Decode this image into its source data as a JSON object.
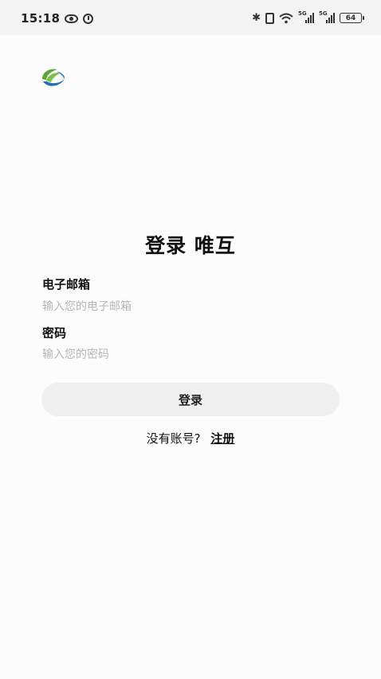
{
  "status_bar": {
    "time": "15:18",
    "network_left": "5G",
    "network_right": "5G",
    "battery": "64"
  },
  "login": {
    "title": "登录 唯互",
    "email_label": "电子邮箱",
    "email_placeholder": "输入您的电子邮箱",
    "email_value": "",
    "password_label": "密码",
    "password_placeholder": "输入您的密码",
    "password_value": "",
    "submit_label": "登录",
    "no_account_text": "没有账号?",
    "register_link": "注册"
  },
  "colors": {
    "logo_green": "#5aa53c",
    "logo_blue": "#1f6fb2",
    "button_bg": "#efefef"
  },
  "icons": [
    "eye-icon",
    "alarm-icon",
    "bluetooth-icon",
    "vibrate-icon",
    "wifi-icon",
    "signal-icon",
    "battery-icon",
    "app-logo"
  ]
}
